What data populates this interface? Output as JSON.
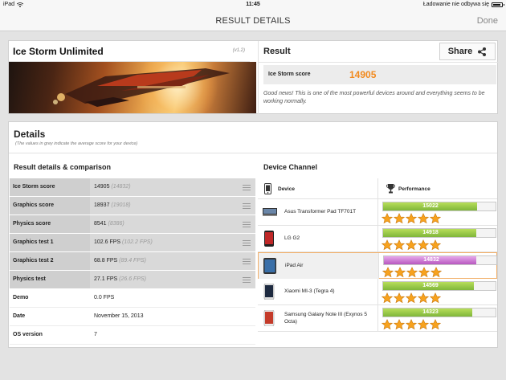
{
  "status": {
    "device": "iPad",
    "time": "11:45",
    "charging": "Ładowanie nie odbywa się"
  },
  "nav": {
    "title": "RESULT DETAILS",
    "done": "Done"
  },
  "test": {
    "name": "Ice Storm Unlimited",
    "version": "(v1.2)"
  },
  "result": {
    "title": "Result",
    "share": "Share",
    "score_label": "Ice Storm score",
    "score": "14905",
    "message": "Good news! This is one of the most powerful devices around and everything seems to be working normally."
  },
  "details": {
    "title": "Details",
    "note": "(The values in grey indicate the average score for your device)",
    "comparison_title": "Result details & comparison",
    "rows": [
      {
        "label": "Ice Storm score",
        "value": "14905",
        "avg": "(14832)"
      },
      {
        "label": "Graphics score",
        "value": "18937",
        "avg": "(19018)"
      },
      {
        "label": "Physics score",
        "value": "8541",
        "avg": "(8386)"
      },
      {
        "label": "Graphics test 1",
        "value": "102.6 FPS",
        "avg": "(102.2 FPS)"
      },
      {
        "label": "Graphics test 2",
        "value": "68.8 FPS",
        "avg": "(89.4 FPS)"
      },
      {
        "label": "Physics test",
        "value": "27.1 FPS",
        "avg": "(26.6 FPS)"
      },
      {
        "label": "Demo",
        "value": "0.0 FPS",
        "avg": ""
      },
      {
        "label": "Date",
        "value": "November 15, 2013",
        "avg": ""
      },
      {
        "label": "OS version",
        "value": "7",
        "avg": ""
      }
    ]
  },
  "channel": {
    "title": "Device Channel",
    "col_device": "Device",
    "col_performance": "Performance",
    "devices": [
      {
        "name": "Asus Transformer Pad TF701T",
        "score": "15022",
        "fill": 0.96,
        "stars": 5,
        "highlight": false
      },
      {
        "name": "LG G2",
        "score": "14918",
        "fill": 0.95,
        "stars": 5,
        "highlight": false
      },
      {
        "name": "iPad Air",
        "score": "14832",
        "fill": 0.945,
        "stars": 5,
        "highlight": true
      },
      {
        "name": "Xiaomi MI-3 (Tegra 4)",
        "score": "14569",
        "fill": 0.93,
        "stars": 5,
        "highlight": false
      },
      {
        "name": "Samsung Galaxy Note III (Exynos 5 Octa)",
        "score": "14323",
        "fill": 0.91,
        "stars": 5,
        "highlight": false
      }
    ]
  },
  "colors": {
    "accent": "#f28a1e",
    "bar_green": "#8fc043",
    "bar_purple": "#c56bcc"
  }
}
